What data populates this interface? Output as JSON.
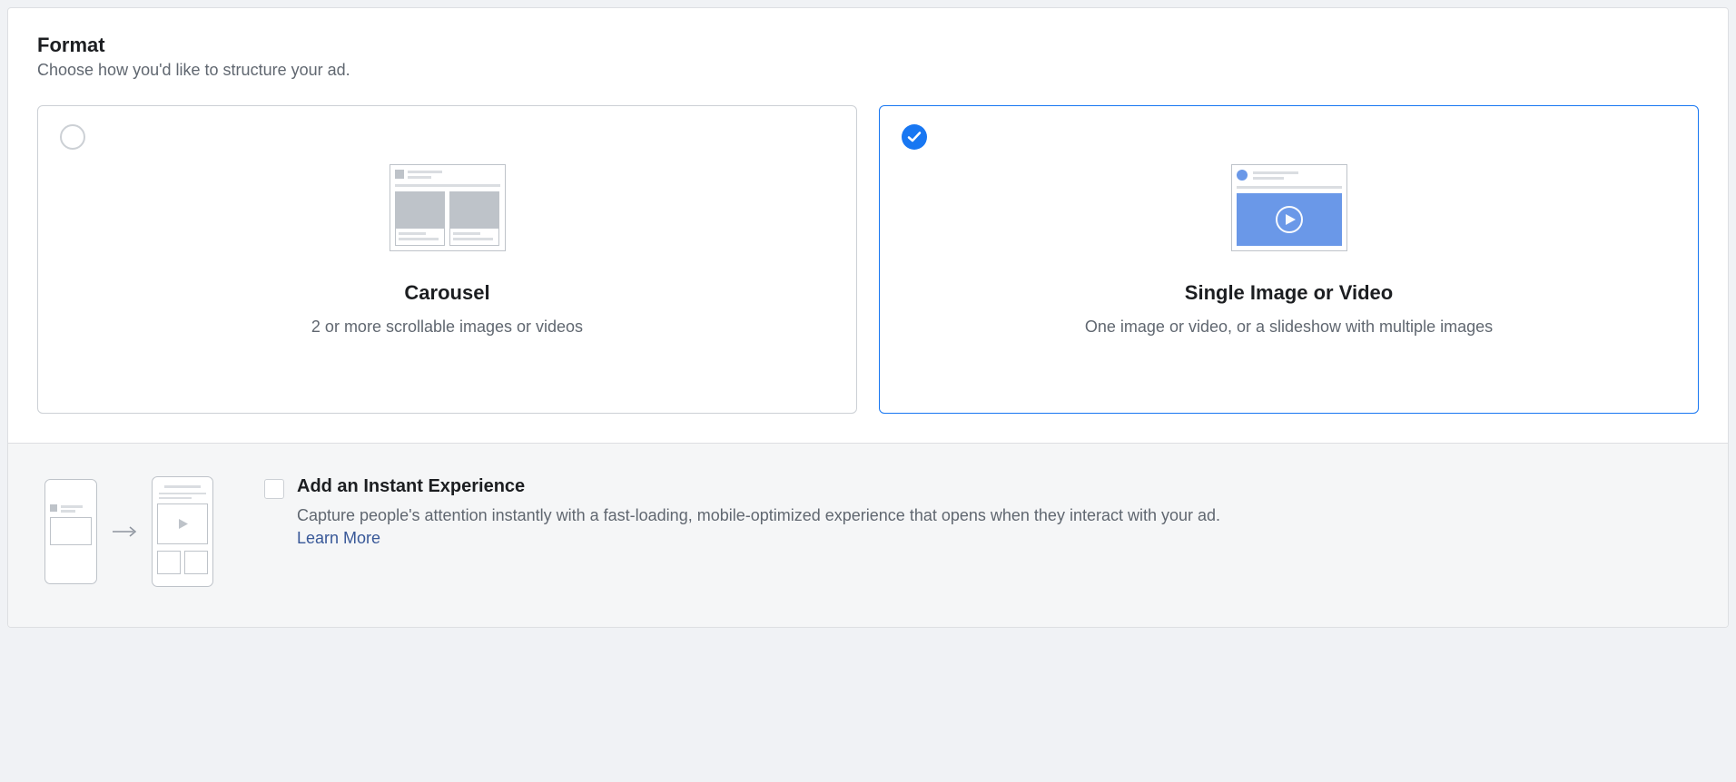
{
  "format": {
    "title": "Format",
    "subtitle": "Choose how you'd like to structure your ad.",
    "options": [
      {
        "title": "Carousel",
        "description": "2 or more scrollable images or videos",
        "selected": false
      },
      {
        "title": "Single Image or Video",
        "description": "One image or video, or a slideshow with multiple images",
        "selected": true
      }
    ]
  },
  "instantExperience": {
    "title": "Add an Instant Experience",
    "description": "Capture people's attention instantly with a fast-loading, mobile-optimized experience that opens when they interact with your ad.",
    "learnMore": "Learn More",
    "checked": false
  }
}
